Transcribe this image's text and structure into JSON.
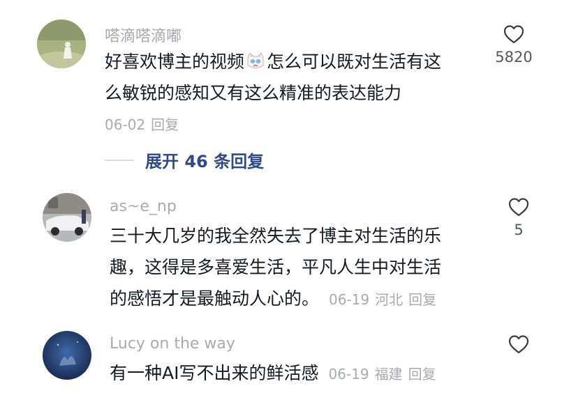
{
  "comments": [
    {
      "username": "嗒滴嗒滴嘟",
      "text_lines": [
        "好喜欢博主的视频",
        "怎么可以既对生活有这",
        "么敏锐的感知又有这么精准的表达能力"
      ],
      "date": "06-02",
      "location": "",
      "reply_label": "回复",
      "likes": "5820",
      "emoji": "crying-cat-emoji"
    },
    {
      "username": "as~e_np",
      "text_lines": [
        "三十大几岁的我全然失去了博主对生活的乐",
        "趣，这得是多喜爱生活，平凡人生中对生活",
        "的感悟才是最触动人心的。"
      ],
      "date": "06-19",
      "location": "河北",
      "reply_label": "回复",
      "likes": "5"
    },
    {
      "username": "Lucy on the way",
      "text_lines": [
        "有一种AI写不出来的鲜活感"
      ],
      "date": "06-19",
      "location": "福建",
      "reply_label": "回复",
      "likes": ""
    }
  ],
  "expand_replies": "展开 46 条回复",
  "icons": {
    "like": "heart-outline-icon"
  },
  "colors": {
    "username": "#a8aab0",
    "text": "#161823",
    "expand": "#2e4a8a",
    "meta": "#a8aab0"
  }
}
